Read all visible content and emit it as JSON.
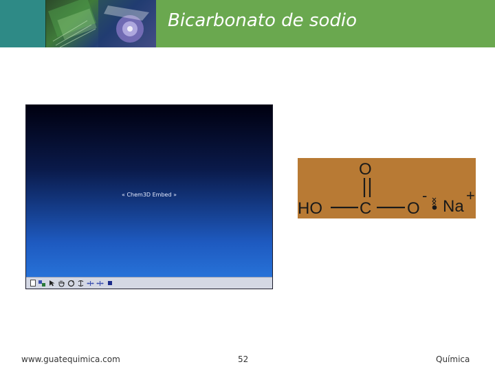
{
  "slide": {
    "title": "Bicarbonato de sodio"
  },
  "viewer": {
    "label": "« Chem3D Embed »"
  },
  "molecule": {
    "atoms": {
      "top_oxygen": "O",
      "hydroxyl": "HO",
      "carbon": "C",
      "oxygen_anion": "O",
      "anion_charge": "-",
      "sodium": "Na",
      "cation_charge": "+"
    }
  },
  "footer": {
    "website": "www.guatequimica.com",
    "page_number": "52",
    "subject": "Química"
  },
  "colors": {
    "header_green": "#6aa84f",
    "header_teal": "#2e8a86",
    "formula_background": "#b87a34"
  }
}
